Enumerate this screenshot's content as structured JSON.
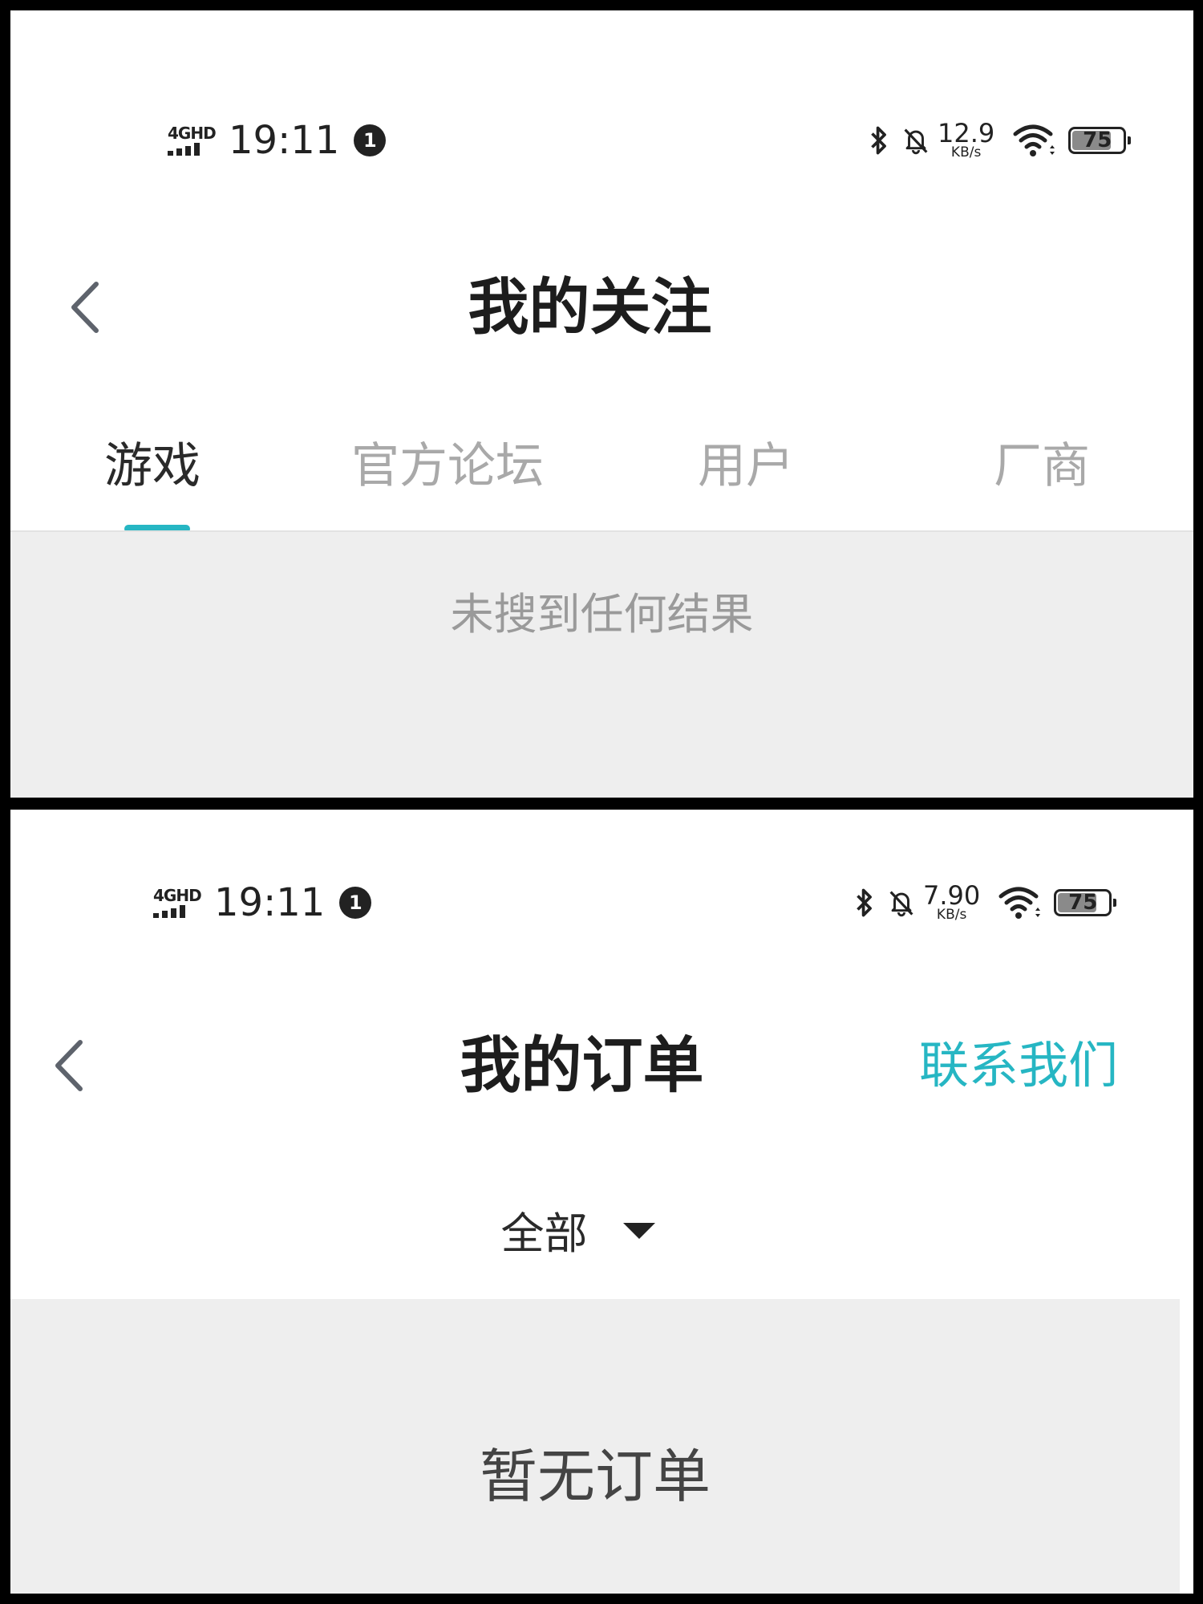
{
  "screens": [
    {
      "status_bar": {
        "network": "4GHD",
        "time": "19:11",
        "notification_count": "1",
        "speed_value": "12.9",
        "speed_unit": "KB/s",
        "battery": "75",
        "battery_level": 0.75
      },
      "title": "我的关注",
      "tabs": [
        {
          "label": "游戏",
          "active": true
        },
        {
          "label": "官方论坛",
          "active": false
        },
        {
          "label": "用户",
          "active": false
        },
        {
          "label": "厂商",
          "active": false
        }
      ],
      "empty_message": "未搜到任何结果"
    },
    {
      "status_bar": {
        "network": "4GHD",
        "time": "19:11",
        "notification_count": "1",
        "speed_value": "7.90",
        "speed_unit": "KB/s",
        "battery": "75",
        "battery_level": 0.75
      },
      "title": "我的订单",
      "action_label": "联系我们",
      "filter_label": "全部",
      "empty_message": "暂无订单"
    }
  ],
  "colors": {
    "accent": "#26b6c3",
    "empty_background": "#eeeeee",
    "inactive_tab": "#a9a9a9"
  },
  "icons": [
    "back-arrow-icon",
    "bluetooth-icon",
    "bell-off-icon",
    "wifi-icon",
    "battery-icon",
    "caret-down-icon"
  ]
}
